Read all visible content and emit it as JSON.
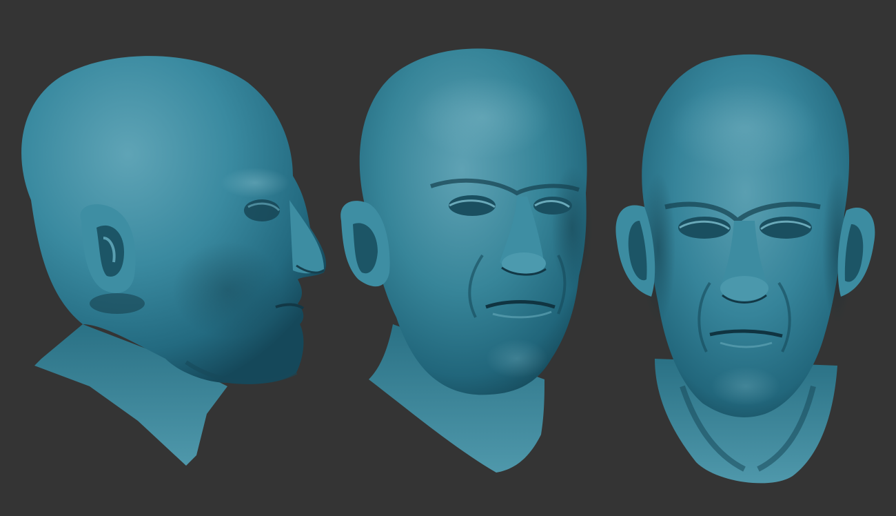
{
  "scene": {
    "background_color": "#343434",
    "material_colors": {
      "skin_base": "#2f7d92",
      "skin_highlight": "#7fb8c6",
      "skin_shadow": "#1b4f60",
      "deep_shadow": "#0f2f3a"
    },
    "views": [
      "side-profile",
      "three-quarter",
      "front"
    ]
  }
}
